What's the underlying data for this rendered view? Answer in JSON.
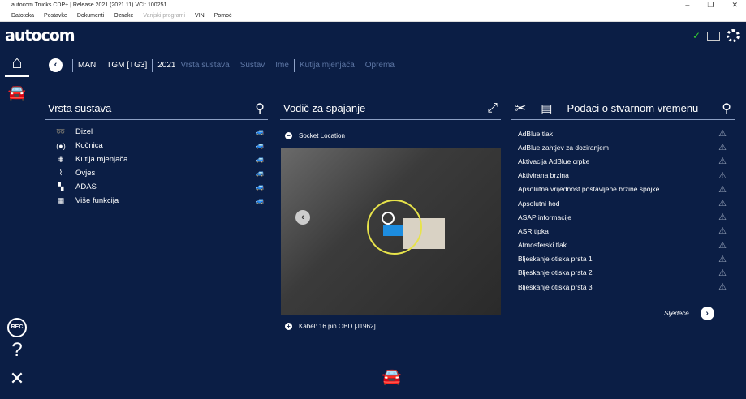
{
  "window": {
    "title": "autocom Trucks CDP+ | Release 2021 (2021.11) VCI: 100251",
    "minimize": "–",
    "restore": "❐",
    "close": "✕"
  },
  "menu": [
    "Datoteka",
    "Postavke",
    "Dokumenti",
    "Oznake",
    "Vanjski programi",
    "VIN",
    "Pomoć"
  ],
  "logo": "autocom",
  "status": {
    "check": "✓",
    "icons": [
      "vci-connected-check",
      "battery-icon",
      "loading-spinner-icon"
    ]
  },
  "breadcrumb": {
    "items": [
      "MAN",
      "TGM [TG3]",
      "2021"
    ],
    "dim_items": [
      "Vrsta sustava",
      "Sustav",
      "Ime",
      "Kutija mjenjača",
      "Oprema"
    ]
  },
  "systems": {
    "title": "Vrsta sustava",
    "items": [
      {
        "label": "Dizel",
        "icon": "turbo-icon"
      },
      {
        "label": "Kočnica",
        "icon": "brake-icon"
      },
      {
        "label": "Kutija mjenjača",
        "icon": "gearbox-icon"
      },
      {
        "label": "Ovjes",
        "icon": "suspension-icon"
      },
      {
        "label": "ADAS",
        "icon": "adas-icon"
      },
      {
        "label": "Više funkcija",
        "icon": "multi-function-icon"
      }
    ]
  },
  "guide": {
    "title": "Vodič za spajanje",
    "socket": "Socket Location",
    "cable": "Kabel: 16 pin OBD [J1962]"
  },
  "realtime": {
    "title": "Podaci o stvarnom vremenu",
    "items": [
      "AdBlue tlak",
      "AdBlue zahtjev za doziranjem",
      "Aktivacija AdBlue crpke",
      "Aktivirana brzina",
      "Apsolutna vrijednost postavljene brzine spojke",
      "Apsolutni hod",
      "ASAP informacije",
      "ASR tipka",
      "Atmosferski tlak",
      "Bljeskanje otiska prsta 1",
      "Bljeskanje otiska prsta 2",
      "Bljeskanje otiska prsta 3"
    ],
    "next": "Sljedeće"
  },
  "sidebar": {
    "rec": "REC",
    "help": "?",
    "exit": "✕"
  },
  "colors": {
    "background": "#0b1e45",
    "highlight": "#e7e34a"
  }
}
